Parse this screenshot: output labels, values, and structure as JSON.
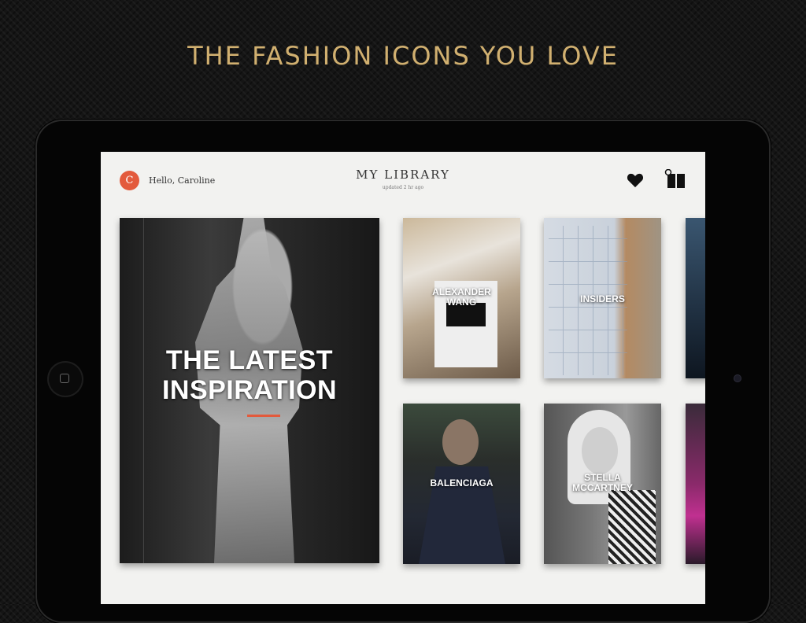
{
  "promo": {
    "headline": "THE FASHION ICONS YOU LOVE"
  },
  "header": {
    "avatar_initial": "C",
    "greeting": "Hello, Caroline",
    "title": "MY LIBRARY",
    "subtitle": "updated 2 hr ago",
    "icons": [
      "heart-icon",
      "shopping-bag-icon"
    ]
  },
  "library": {
    "feature": {
      "label": "THE LATEST\nINSPIRATION"
    },
    "tiles": [
      {
        "label": "ALEXANDER\nWANG"
      },
      {
        "label": "INSIDERS"
      },
      {
        "label": "BALENCIAGA"
      },
      {
        "label": "STELLA\nMCCARTNEY"
      }
    ]
  },
  "colors": {
    "headline_gold": "#d1b070",
    "accent": "#e35a3c"
  }
}
